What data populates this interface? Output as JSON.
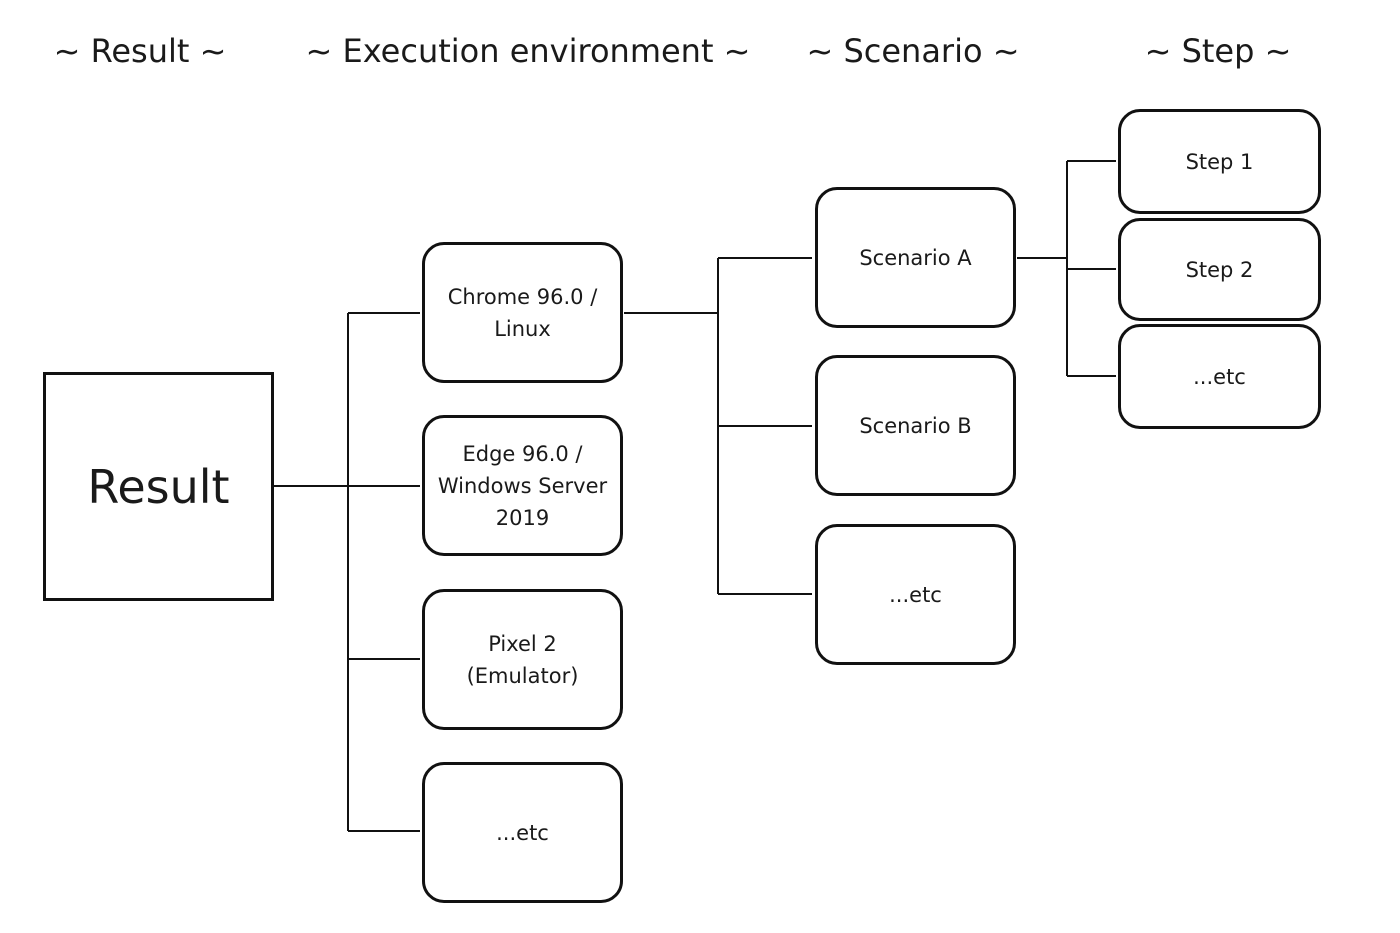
{
  "headers": {
    "result": "~ Result ~",
    "environment": "~ Execution environment ~",
    "scenario": "~ Scenario ~",
    "step": "~ Step ~"
  },
  "result": {
    "label": "Result"
  },
  "environments": [
    {
      "label": "Chrome 96.0 /\nLinux"
    },
    {
      "label": "Edge 96.0 /\nWindows Server\n2019"
    },
    {
      "label": "Pixel 2\n(Emulator)"
    },
    {
      "label": "...etc"
    }
  ],
  "scenarios": [
    {
      "label": "Scenario A"
    },
    {
      "label": "Scenario B"
    },
    {
      "label": "...etc"
    }
  ],
  "steps": [
    {
      "label": "Step 1"
    },
    {
      "label": "Step 2"
    },
    {
      "label": "...etc"
    }
  ]
}
